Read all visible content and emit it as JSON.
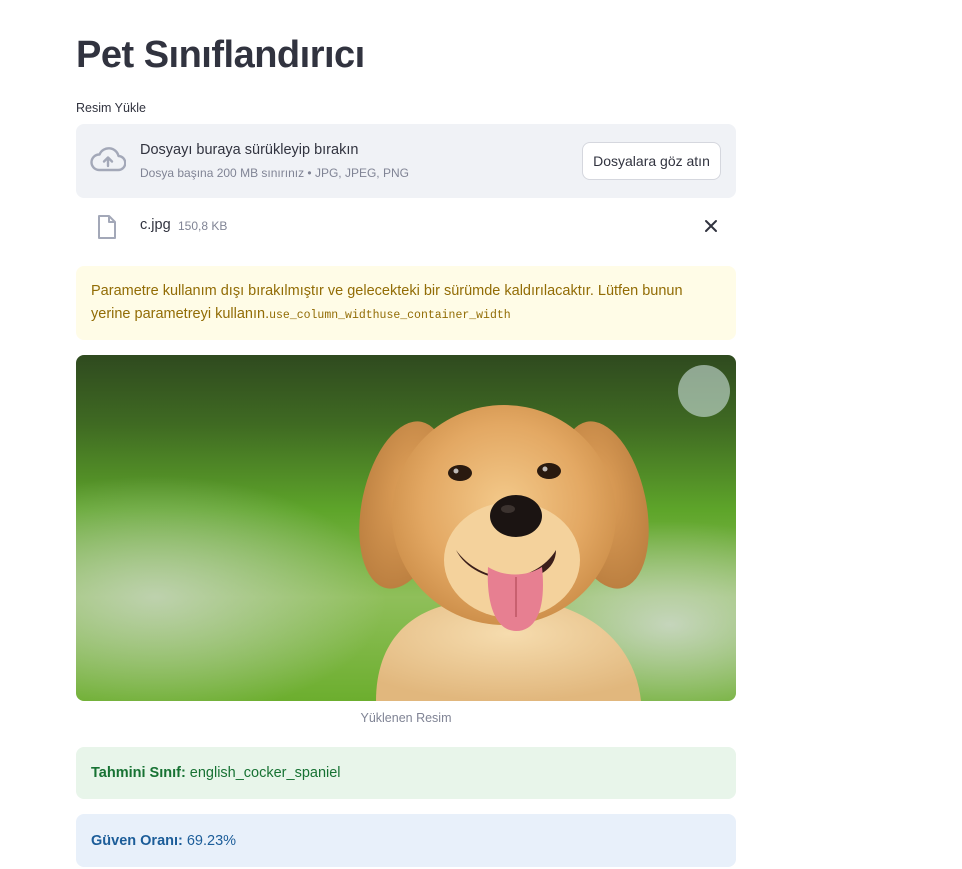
{
  "page": {
    "title": "Pet Sınıflandırıcı"
  },
  "uploader": {
    "label": "Resim Yükle",
    "drop_text": "Dosyayı buraya sürükleyip bırakın",
    "limit_text": "Dosya başına 200 MB sınırınız • JPG, JPEG, PNG",
    "browse_label": "Dosyalara göz atın",
    "icon": "cloud-upload-icon"
  },
  "uploaded_file": {
    "name": "c.jpg",
    "size": "150,8 KB",
    "icon": "file-icon",
    "remove_icon": "close-icon"
  },
  "warning": {
    "text": "Parametre kullanım dışı bırakılmıştır ve gelecekteki bir sürümde kaldırılacaktır. Lütfen bunun yerine parametreyi kullanın.",
    "code": "use_column_widthuse_container_width"
  },
  "image": {
    "caption": "Yüklenen Resim"
  },
  "result": {
    "class_label": "Tahmini Sınıf:",
    "class_value": "english_cocker_spaniel",
    "confidence_label": "Güven Oranı:",
    "confidence_value": "69.23%"
  },
  "colors": {
    "warning_bg": "#fffce7",
    "warning_text": "#926c05",
    "success_bg": "#e8f5ea",
    "success_text": "#177233",
    "info_bg": "#e8f0fa",
    "info_text": "#1c5d99",
    "dropzone_bg": "#f0f2f6"
  }
}
